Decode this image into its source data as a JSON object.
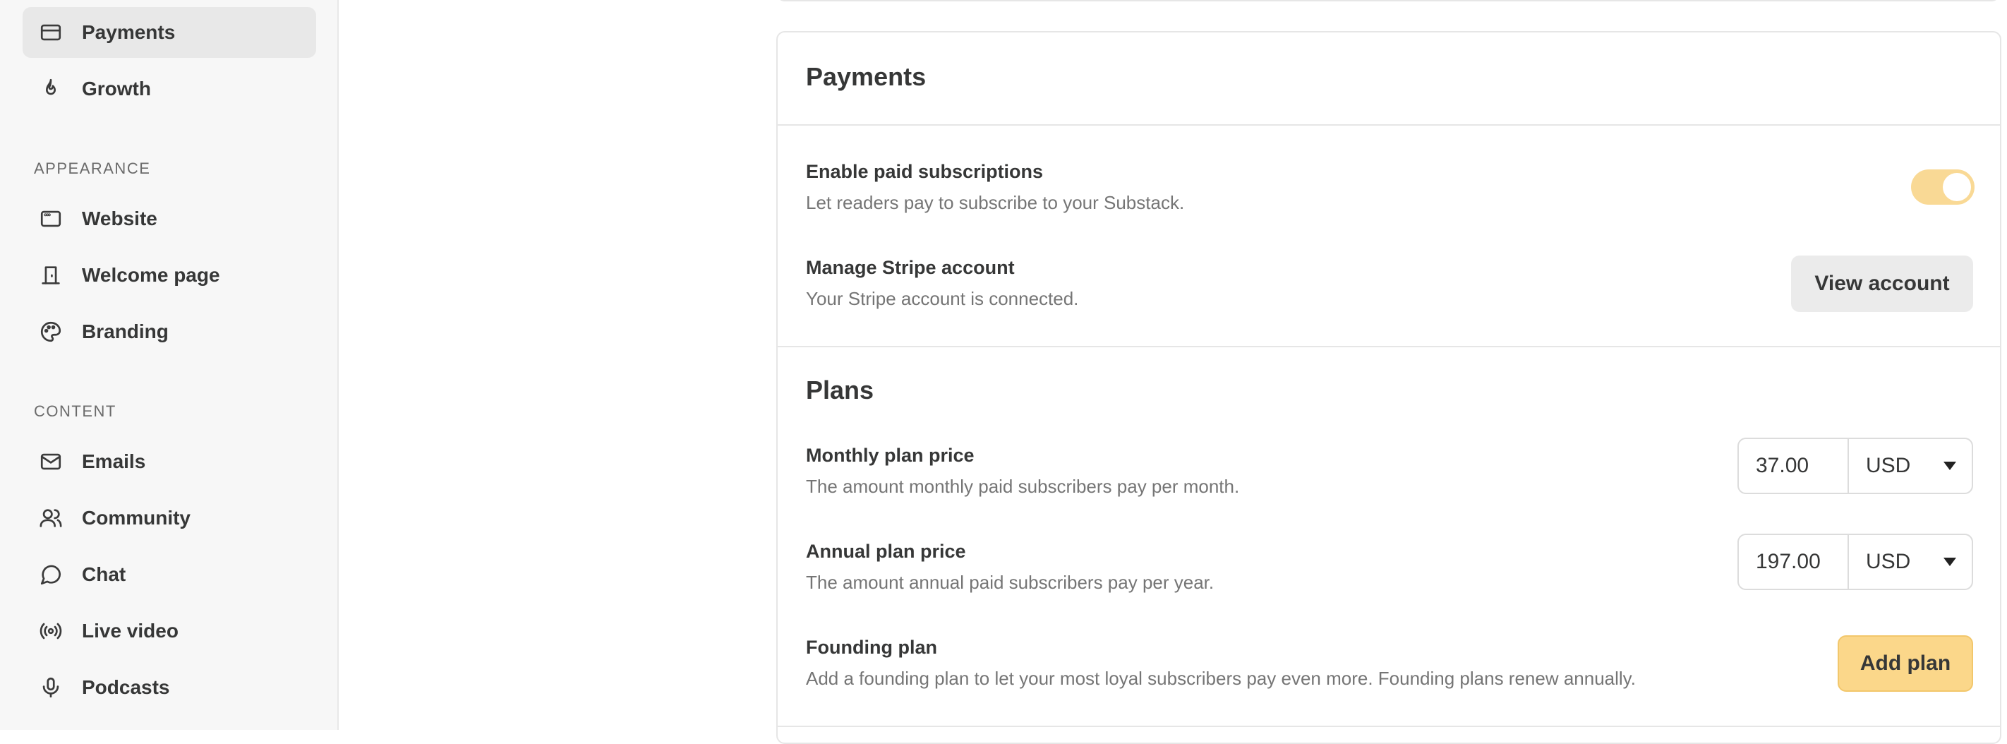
{
  "sidebar": {
    "items_top": [
      {
        "label": "Payments",
        "icon": "credit-card-icon"
      },
      {
        "label": "Growth",
        "icon": "flame-icon"
      }
    ],
    "appearance_label": "APPEARANCE",
    "appearance": [
      {
        "label": "Website",
        "icon": "browser-window-icon"
      },
      {
        "label": "Welcome page",
        "icon": "door-icon"
      },
      {
        "label": "Branding",
        "icon": "palette-icon"
      }
    ],
    "content_label": "CONTENT",
    "content": [
      {
        "label": "Emails",
        "icon": "mail-icon"
      },
      {
        "label": "Community",
        "icon": "users-icon"
      },
      {
        "label": "Chat",
        "icon": "chat-bubble-icon"
      },
      {
        "label": "Live video",
        "icon": "broadcast-icon"
      },
      {
        "label": "Podcasts",
        "icon": "microphone-icon"
      }
    ]
  },
  "payments": {
    "title": "Payments",
    "enable": {
      "title": "Enable paid subscriptions",
      "desc": "Let readers pay to subscribe to your Substack.",
      "enabled": true
    },
    "stripe": {
      "title": "Manage Stripe account",
      "desc": "Your Stripe account is connected.",
      "button": "View account"
    }
  },
  "plans": {
    "title": "Plans",
    "monthly": {
      "title": "Monthly plan price",
      "desc": "The amount monthly paid subscribers pay per month.",
      "price": "37.00",
      "currency": "USD"
    },
    "annual": {
      "title": "Annual plan price",
      "desc": "The amount annual paid subscribers pay per year.",
      "price": "197.00",
      "currency": "USD"
    },
    "founding": {
      "title": "Founding plan",
      "desc": "Add a founding plan to let your most loyal subscribers pay even more. Founding plans renew annually.",
      "button": "Add plan"
    }
  },
  "colors": {
    "accent": "#fbd78a",
    "toggle_on": "#f9d995",
    "sidebar_bg": "#f7f7f7"
  }
}
